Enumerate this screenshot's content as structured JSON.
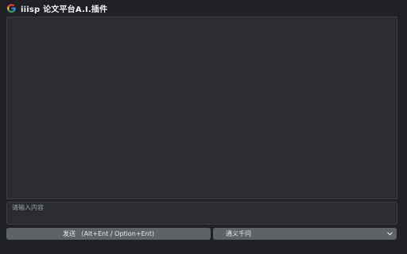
{
  "header": {
    "logo_letter": "G",
    "title": "iiisp 论文平台A.I.插件",
    "logo_colors": [
      "#4285F4",
      "#EA4335",
      "#FBBC05",
      "#34A853"
    ]
  },
  "chat": {
    "messages": []
  },
  "input": {
    "placeholder": "请输入内容",
    "value": ""
  },
  "send_button": {
    "label": "发送 （Alt+Ent / Option+Ent)"
  },
  "model_select": {
    "selected": "通义千问",
    "icon": "chevron-down-icon"
  },
  "colors": {
    "background": "#202124",
    "panel": "#2a2c30",
    "border": "#3a3d42",
    "button": "#5f6368",
    "text": "#e8eaed",
    "placeholder": "#9aa0a6"
  }
}
